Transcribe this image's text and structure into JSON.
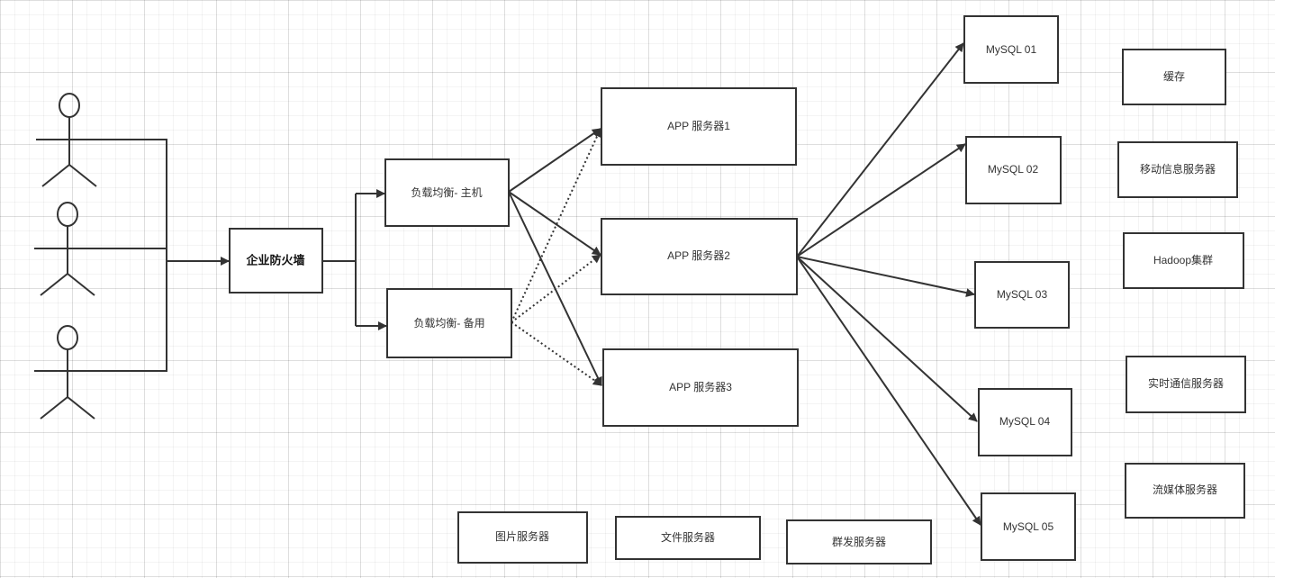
{
  "firewall": "企业防火墙",
  "load_balancers": [
    "负载均衡- 主机",
    "负载均衡- 备用"
  ],
  "app_servers": [
    "APP 服务器1",
    "APP 服务器2",
    "APP 服务器3"
  ],
  "databases": [
    "MySQL 01",
    "MySQL 02",
    "MySQL 03",
    "MySQL 04",
    "MySQL 05"
  ],
  "other_services": [
    "缓存",
    "移动信息服务器",
    "Hadoop集群",
    "实时通信服务器",
    "流媒体服务器"
  ],
  "bottom_services": [
    "图片服务器",
    "文件服务器",
    "群发服务器"
  ],
  "users_count": 3
}
